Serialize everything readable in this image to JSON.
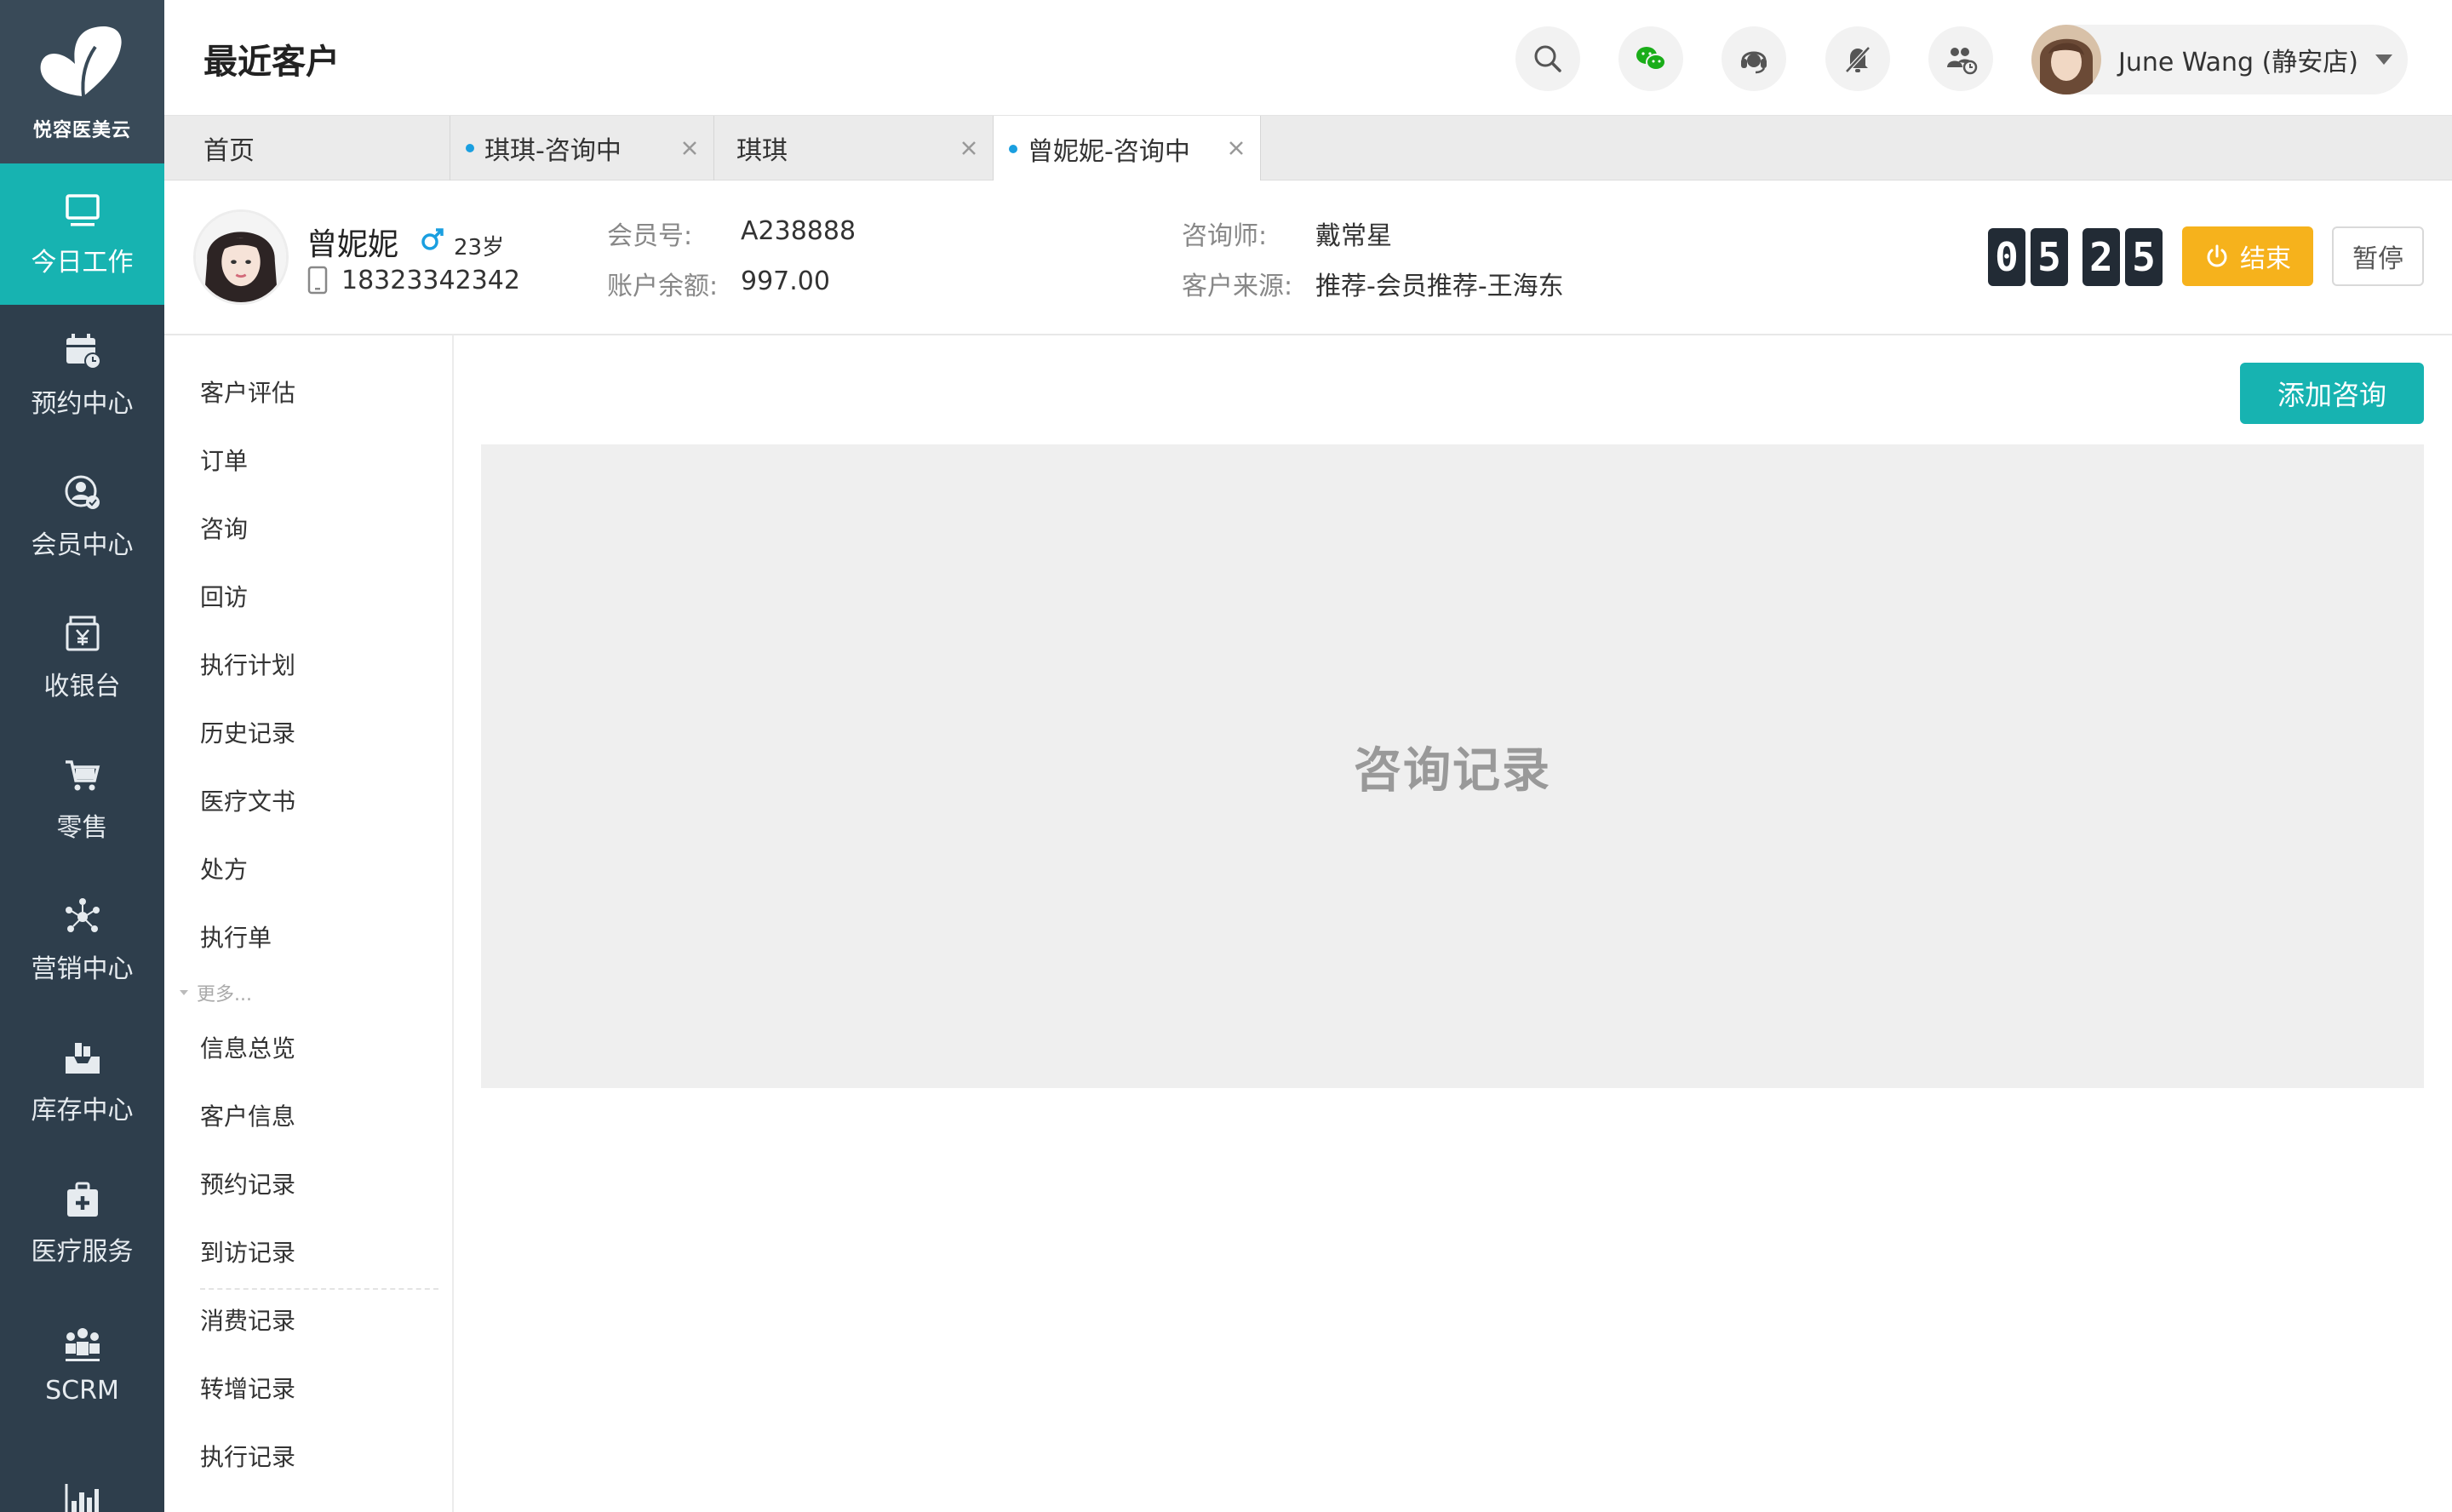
{
  "brand": {
    "logo_text": "悦容医美云",
    "accent": "#17b3b1",
    "sidebar_bg": "#2e3e4c"
  },
  "sidebar": {
    "items": [
      {
        "label": "今日工作",
        "icon": "monitor-icon",
        "active": true
      },
      {
        "label": "预约中心",
        "icon": "calendar-clock-icon",
        "active": false
      },
      {
        "label": "会员中心",
        "icon": "member-icon",
        "active": false
      },
      {
        "label": "收银台",
        "icon": "cashier-icon",
        "active": false
      },
      {
        "label": "零售",
        "icon": "cart-icon",
        "active": false
      },
      {
        "label": "营销中心",
        "icon": "network-icon",
        "active": false
      },
      {
        "label": "库存中心",
        "icon": "inventory-icon",
        "active": false
      },
      {
        "label": "医疗服务",
        "icon": "medical-kit-icon",
        "active": false
      },
      {
        "label": "SCRM",
        "icon": "people-icon",
        "active": false
      },
      {
        "label": "",
        "icon": "bar-chart-icon",
        "active": false
      }
    ]
  },
  "header": {
    "title": "最近客户",
    "icons": [
      "search-icon",
      "wechat-icon",
      "headset-icon",
      "mute-bell-icon",
      "team-clock-icon"
    ],
    "user": {
      "name": "June Wang (静安店)"
    }
  },
  "tabs": [
    {
      "label": "首页",
      "dot": false,
      "closable": false,
      "active": false
    },
    {
      "label": "琪琪-咨询中",
      "dot": true,
      "closable": true,
      "active": false
    },
    {
      "label": "琪琪",
      "dot": false,
      "closable": true,
      "active": false
    },
    {
      "label": "曾妮妮-咨询中",
      "dot": true,
      "closable": true,
      "active": true
    }
  ],
  "customer": {
    "name": "曾妮妮",
    "age": "23岁",
    "phone": "18323342342",
    "member_no_label": "会员号:",
    "member_no": "A238888",
    "balance_label": "账户余额:",
    "balance": "997.00",
    "consultant_label": "咨询师:",
    "consultant": "戴常星",
    "source_label": "客户来源:",
    "source": "推荐-会员推荐-王海东"
  },
  "timer": {
    "digits": [
      "0",
      "5",
      "2",
      "5"
    ]
  },
  "actions": {
    "end": "结束",
    "pause": "暂停",
    "add_consult": "添加咨询"
  },
  "subnav": {
    "primary": [
      "客户评估",
      "订单",
      "咨询",
      "回访",
      "执行计划",
      "历史记录",
      "医疗文书",
      "处方",
      "执行单"
    ],
    "more_label": "更多...",
    "secondary": [
      "信息总览",
      "客户信息",
      "预约记录",
      "到访记录",
      "消费记录",
      "转增记录",
      "执行记录"
    ]
  },
  "main": {
    "panel_label": "咨询记录"
  }
}
